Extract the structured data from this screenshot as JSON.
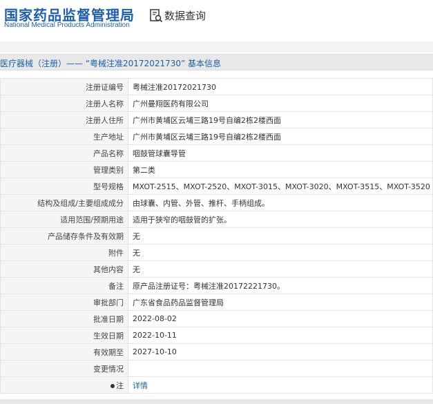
{
  "header": {
    "logo_cn": "国家药品监督管理局",
    "logo_en": "National Medical Products Administration",
    "query_label": "数据查询",
    "query_icon": "search-document-icon"
  },
  "breadcrumb": {
    "text": "医疗器械（注册）——  “粤械注准20172021730” 基本信息"
  },
  "rows": [
    {
      "label": "注册证编号",
      "value": "粤械注准20172021730"
    },
    {
      "label": "注册人名称",
      "value": "广州曼翔医药有限公司"
    },
    {
      "label": "注册人住所",
      "value": "广州市黄埔区云埔三路19号自编2栋2楼西面"
    },
    {
      "label": "生产地址",
      "value": "广州市黄埔区云埔三路19号自编2栋2楼西面"
    },
    {
      "label": "产品名称",
      "value": "咽鼓管球囊导管"
    },
    {
      "label": "管理类别",
      "value": "第二类"
    },
    {
      "label": "型号规格",
      "value": "MXOT-2515、MXOT-2520、MXOT-3015、MXOT-3020、MXOT-3515、MXOT-3520"
    },
    {
      "label": "结构及组成/主要组成成分",
      "value": "由球囊、内管、外管、推杆、手柄组成。"
    },
    {
      "label": "适用范围/预期用途",
      "value": "适用于狭窄的咽鼓管的扩张。"
    },
    {
      "label": "产品储存条件及有效期",
      "value": "无"
    },
    {
      "label": "附件",
      "value": "无"
    },
    {
      "label": "其他内容",
      "value": "无"
    },
    {
      "label": "备注",
      "value": "原产品注册证号：粤械注准20172221730。"
    },
    {
      "label": "审批部门",
      "value": "广东省食品药品监督管理局"
    },
    {
      "label": "批准日期",
      "value": "2022-08-02"
    },
    {
      "label": "生效日期",
      "value": "2022-10-11"
    },
    {
      "label": "有效期至",
      "value": "2027-10-10"
    },
    {
      "label": "变更情况",
      "value": ""
    }
  ],
  "note_row": {
    "label": "注",
    "value": "详情"
  }
}
